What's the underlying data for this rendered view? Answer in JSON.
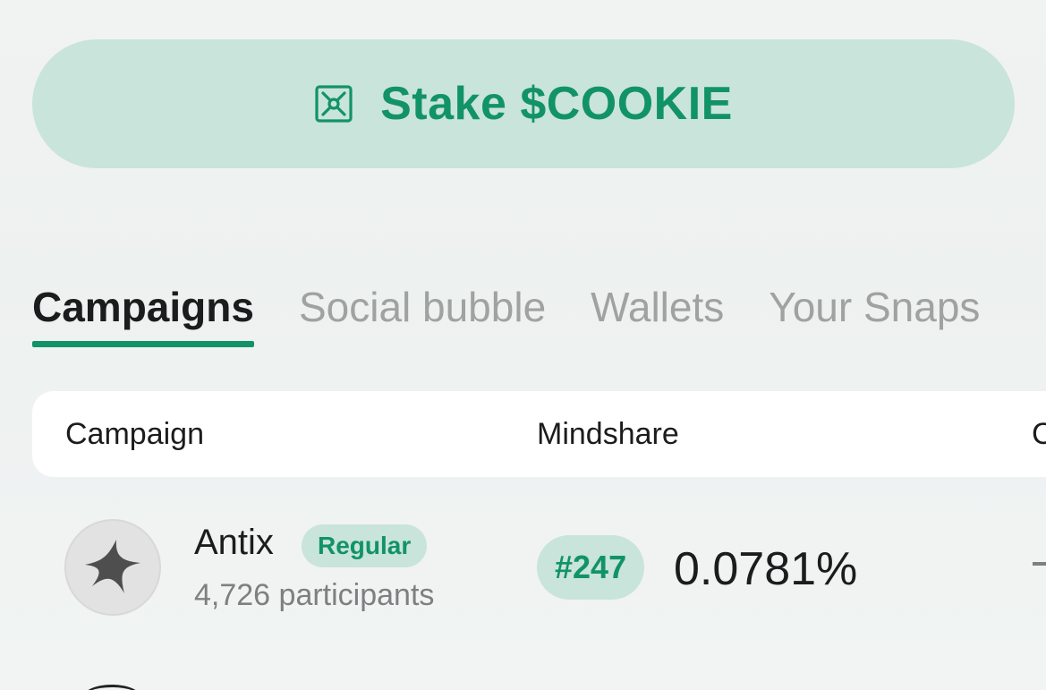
{
  "stake": {
    "label": "Stake $COOKIE",
    "icon": "vault-icon"
  },
  "tabs": [
    {
      "label": "Campaigns",
      "active": true
    },
    {
      "label": "Social bubble",
      "active": false
    },
    {
      "label": "Wallets",
      "active": false
    },
    {
      "label": "Your Snaps",
      "active": false
    }
  ],
  "table": {
    "columns": [
      "Campaign",
      "Mindshare",
      "C"
    ],
    "rows": [
      {
        "name": "Antix",
        "badge": "Regular",
        "participants": "4,726 participants",
        "rank": "#247",
        "mindshare": "0.0781%",
        "third": "-"
      }
    ]
  },
  "colors": {
    "accent": "#129367",
    "accent_bg": "#c9e4db",
    "text": "#1b1c1d",
    "muted": "#9fa2a1"
  }
}
